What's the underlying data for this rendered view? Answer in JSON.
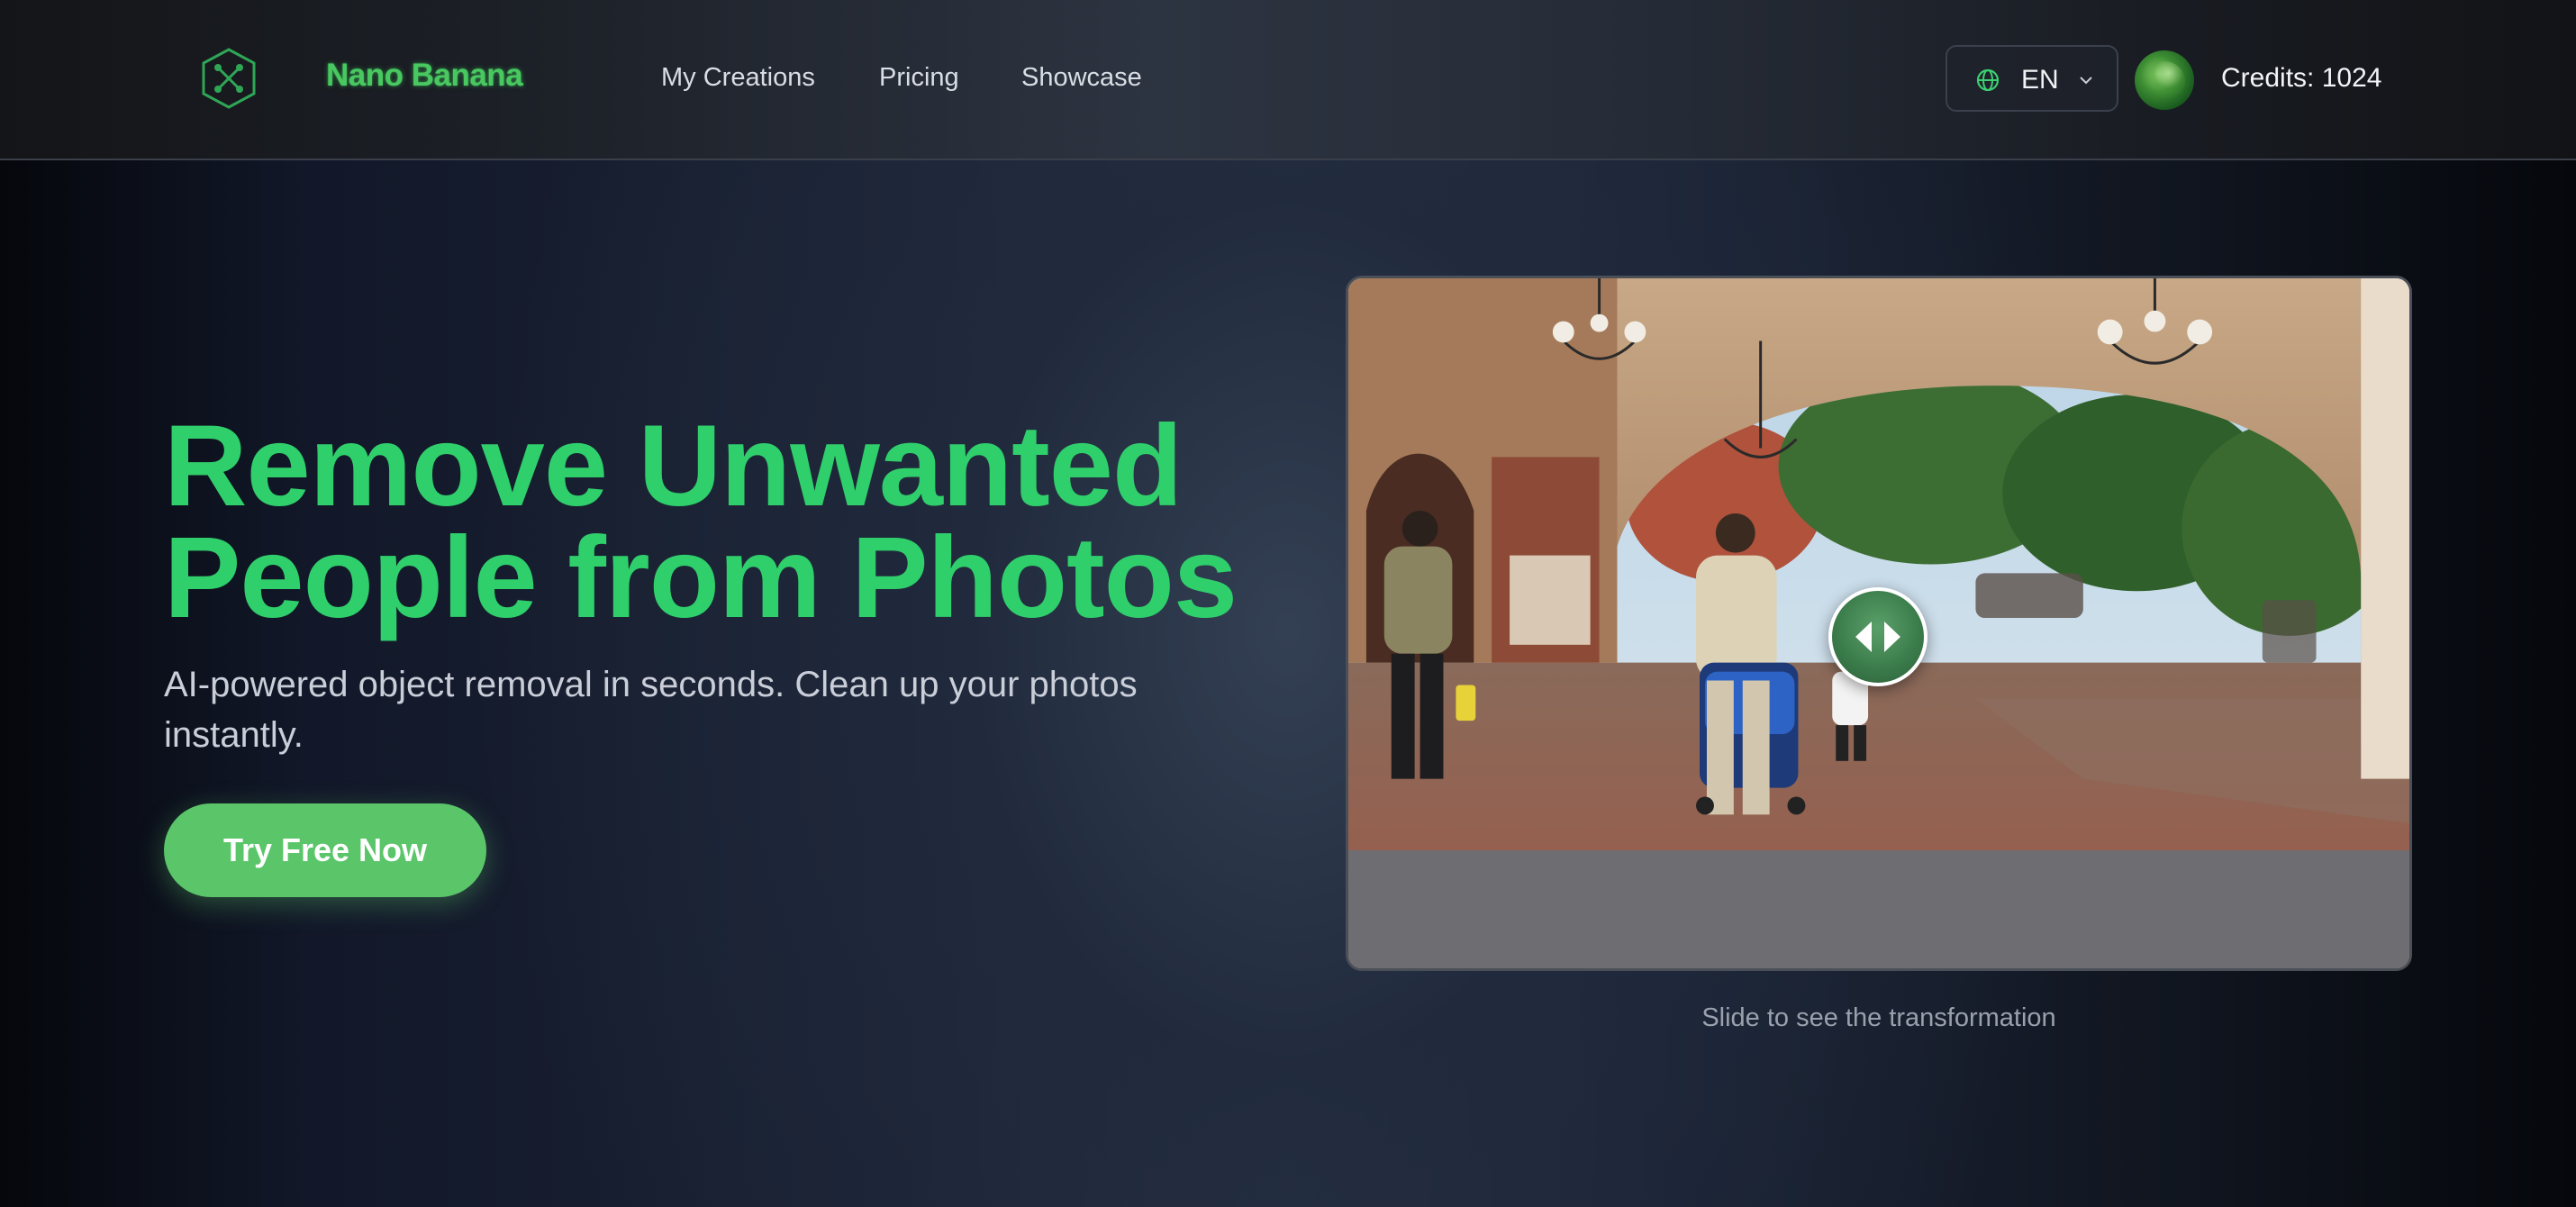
{
  "header": {
    "brand": "Nano Banana",
    "logo_icon": "hexagon-network-icon",
    "nav": [
      {
        "label": "My Creations"
      },
      {
        "label": "Pricing"
      },
      {
        "label": "Showcase"
      }
    ],
    "language": {
      "code": "EN",
      "icon": "globe-icon"
    },
    "avatar_icon": "user-avatar",
    "credits": "Credits: 1024"
  },
  "hero": {
    "headline_line1": "Remove Unwanted",
    "headline_line2": "People from Photos",
    "subtitle": "AI-powered object removal in seconds. Clean up your photos instantly.",
    "cta": "Try Free Now",
    "slider_caption": "Slide to see the transformation",
    "slider_handle_icon": "left-right-arrows-icon"
  },
  "colors": {
    "accent_green": "#2fcf6b",
    "button_green": "#5bc56a",
    "brand_green": "#49c861"
  }
}
